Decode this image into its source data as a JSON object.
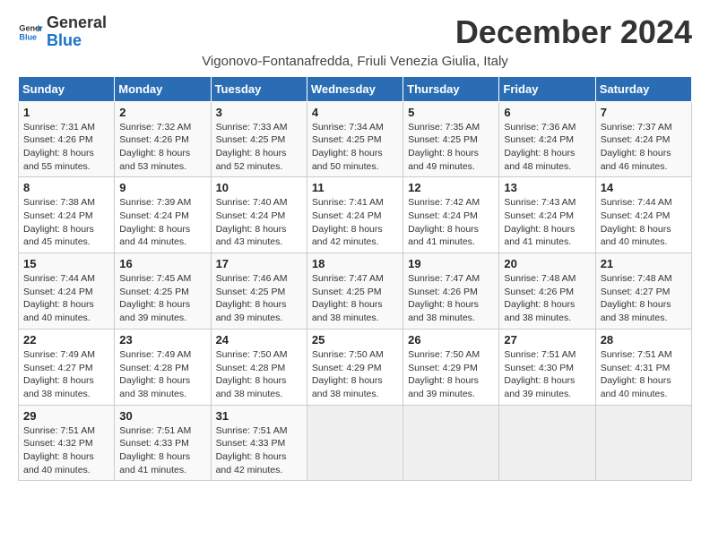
{
  "logo": {
    "text_general": "General",
    "text_blue": "Blue"
  },
  "title": "December 2024",
  "subtitle": "Vigonovo-Fontanafredda, Friuli Venezia Giulia, Italy",
  "weekdays": [
    "Sunday",
    "Monday",
    "Tuesday",
    "Wednesday",
    "Thursday",
    "Friday",
    "Saturday"
  ],
  "weeks": [
    [
      {
        "day": "1",
        "sunrise": "Sunrise: 7:31 AM",
        "sunset": "Sunset: 4:26 PM",
        "daylight": "Daylight: 8 hours and 55 minutes."
      },
      {
        "day": "2",
        "sunrise": "Sunrise: 7:32 AM",
        "sunset": "Sunset: 4:26 PM",
        "daylight": "Daylight: 8 hours and 53 minutes."
      },
      {
        "day": "3",
        "sunrise": "Sunrise: 7:33 AM",
        "sunset": "Sunset: 4:25 PM",
        "daylight": "Daylight: 8 hours and 52 minutes."
      },
      {
        "day": "4",
        "sunrise": "Sunrise: 7:34 AM",
        "sunset": "Sunset: 4:25 PM",
        "daylight": "Daylight: 8 hours and 50 minutes."
      },
      {
        "day": "5",
        "sunrise": "Sunrise: 7:35 AM",
        "sunset": "Sunset: 4:25 PM",
        "daylight": "Daylight: 8 hours and 49 minutes."
      },
      {
        "day": "6",
        "sunrise": "Sunrise: 7:36 AM",
        "sunset": "Sunset: 4:24 PM",
        "daylight": "Daylight: 8 hours and 48 minutes."
      },
      {
        "day": "7",
        "sunrise": "Sunrise: 7:37 AM",
        "sunset": "Sunset: 4:24 PM",
        "daylight": "Daylight: 8 hours and 46 minutes."
      }
    ],
    [
      {
        "day": "8",
        "sunrise": "Sunrise: 7:38 AM",
        "sunset": "Sunset: 4:24 PM",
        "daylight": "Daylight: 8 hours and 45 minutes."
      },
      {
        "day": "9",
        "sunrise": "Sunrise: 7:39 AM",
        "sunset": "Sunset: 4:24 PM",
        "daylight": "Daylight: 8 hours and 44 minutes."
      },
      {
        "day": "10",
        "sunrise": "Sunrise: 7:40 AM",
        "sunset": "Sunset: 4:24 PM",
        "daylight": "Daylight: 8 hours and 43 minutes."
      },
      {
        "day": "11",
        "sunrise": "Sunrise: 7:41 AM",
        "sunset": "Sunset: 4:24 PM",
        "daylight": "Daylight: 8 hours and 42 minutes."
      },
      {
        "day": "12",
        "sunrise": "Sunrise: 7:42 AM",
        "sunset": "Sunset: 4:24 PM",
        "daylight": "Daylight: 8 hours and 41 minutes."
      },
      {
        "day": "13",
        "sunrise": "Sunrise: 7:43 AM",
        "sunset": "Sunset: 4:24 PM",
        "daylight": "Daylight: 8 hours and 41 minutes."
      },
      {
        "day": "14",
        "sunrise": "Sunrise: 7:44 AM",
        "sunset": "Sunset: 4:24 PM",
        "daylight": "Daylight: 8 hours and 40 minutes."
      }
    ],
    [
      {
        "day": "15",
        "sunrise": "Sunrise: 7:44 AM",
        "sunset": "Sunset: 4:24 PM",
        "daylight": "Daylight: 8 hours and 40 minutes."
      },
      {
        "day": "16",
        "sunrise": "Sunrise: 7:45 AM",
        "sunset": "Sunset: 4:25 PM",
        "daylight": "Daylight: 8 hours and 39 minutes."
      },
      {
        "day": "17",
        "sunrise": "Sunrise: 7:46 AM",
        "sunset": "Sunset: 4:25 PM",
        "daylight": "Daylight: 8 hours and 39 minutes."
      },
      {
        "day": "18",
        "sunrise": "Sunrise: 7:47 AM",
        "sunset": "Sunset: 4:25 PM",
        "daylight": "Daylight: 8 hours and 38 minutes."
      },
      {
        "day": "19",
        "sunrise": "Sunrise: 7:47 AM",
        "sunset": "Sunset: 4:26 PM",
        "daylight": "Daylight: 8 hours and 38 minutes."
      },
      {
        "day": "20",
        "sunrise": "Sunrise: 7:48 AM",
        "sunset": "Sunset: 4:26 PM",
        "daylight": "Daylight: 8 hours and 38 minutes."
      },
      {
        "day": "21",
        "sunrise": "Sunrise: 7:48 AM",
        "sunset": "Sunset: 4:27 PM",
        "daylight": "Daylight: 8 hours and 38 minutes."
      }
    ],
    [
      {
        "day": "22",
        "sunrise": "Sunrise: 7:49 AM",
        "sunset": "Sunset: 4:27 PM",
        "daylight": "Daylight: 8 hours and 38 minutes."
      },
      {
        "day": "23",
        "sunrise": "Sunrise: 7:49 AM",
        "sunset": "Sunset: 4:28 PM",
        "daylight": "Daylight: 8 hours and 38 minutes."
      },
      {
        "day": "24",
        "sunrise": "Sunrise: 7:50 AM",
        "sunset": "Sunset: 4:28 PM",
        "daylight": "Daylight: 8 hours and 38 minutes."
      },
      {
        "day": "25",
        "sunrise": "Sunrise: 7:50 AM",
        "sunset": "Sunset: 4:29 PM",
        "daylight": "Daylight: 8 hours and 38 minutes."
      },
      {
        "day": "26",
        "sunrise": "Sunrise: 7:50 AM",
        "sunset": "Sunset: 4:29 PM",
        "daylight": "Daylight: 8 hours and 39 minutes."
      },
      {
        "day": "27",
        "sunrise": "Sunrise: 7:51 AM",
        "sunset": "Sunset: 4:30 PM",
        "daylight": "Daylight: 8 hours and 39 minutes."
      },
      {
        "day": "28",
        "sunrise": "Sunrise: 7:51 AM",
        "sunset": "Sunset: 4:31 PM",
        "daylight": "Daylight: 8 hours and 40 minutes."
      }
    ],
    [
      {
        "day": "29",
        "sunrise": "Sunrise: 7:51 AM",
        "sunset": "Sunset: 4:32 PM",
        "daylight": "Daylight: 8 hours and 40 minutes."
      },
      {
        "day": "30",
        "sunrise": "Sunrise: 7:51 AM",
        "sunset": "Sunset: 4:33 PM",
        "daylight": "Daylight: 8 hours and 41 minutes."
      },
      {
        "day": "31",
        "sunrise": "Sunrise: 7:51 AM",
        "sunset": "Sunset: 4:33 PM",
        "daylight": "Daylight: 8 hours and 42 minutes."
      },
      null,
      null,
      null,
      null
    ]
  ]
}
